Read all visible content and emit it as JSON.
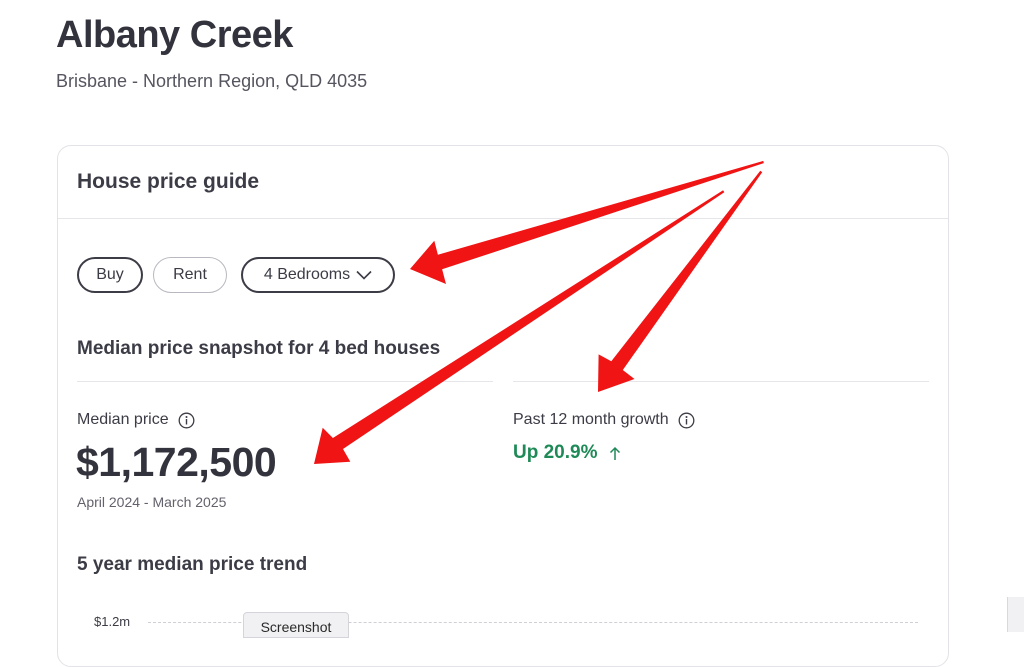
{
  "header": {
    "title": "Albany Creek",
    "subtitle": "Brisbane - Northern Region, QLD 4035"
  },
  "card": {
    "title": "House price guide",
    "filters": {
      "buy_label": "Buy",
      "rent_label": "Rent",
      "bedrooms_label": "4 Bedrooms",
      "selected": "Buy"
    },
    "snapshot_title": "Median price snapshot for 4 bed houses",
    "median": {
      "label": "Median price",
      "value": "$1,172,500",
      "period": "April 2024 - March 2025"
    },
    "growth": {
      "label": "Past 12 month growth",
      "value": "Up 20.9%"
    },
    "trend": {
      "title": "5 year median price trend",
      "y_tick": "$1.2m"
    }
  },
  "overlay": {
    "tooltip_text": "Screenshot",
    "arrow_color": "#f01414"
  },
  "colors": {
    "positive": "#1f8a57",
    "text": "#3c3c46",
    "border": "#e2e2e8"
  },
  "icons": {
    "bedrooms_dropdown": "chevron-down-icon",
    "info": "info-icon",
    "growth": "arrow-up-icon"
  }
}
